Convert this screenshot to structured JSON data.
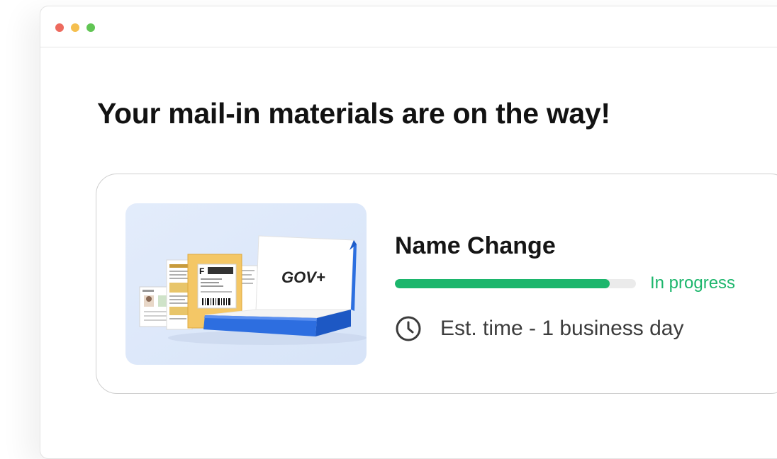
{
  "window": {
    "controls": [
      {
        "name": "close",
        "color": "#ed6a5e"
      },
      {
        "name": "minimize",
        "color": "#f5bf4f"
      },
      {
        "name": "maximize",
        "color": "#61c554"
      }
    ]
  },
  "main": {
    "heading": "Your mail-in materials are on the way!"
  },
  "card": {
    "illustration_icon": "mail-package-illustration",
    "box_brand": "GOV+",
    "form_letter": "F",
    "title": "Name Change",
    "progress": 0.89,
    "progress_color": "#1cb66c",
    "status": "In progress",
    "status_color": "#1cb66c",
    "eta_icon": "clock-icon",
    "eta": "Est. time - 1 business day"
  }
}
